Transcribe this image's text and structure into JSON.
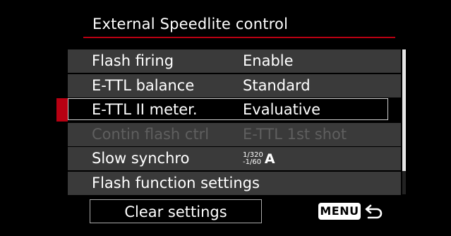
{
  "screen": {
    "title": "External Speedlite control"
  },
  "menu": {
    "items": [
      {
        "label": "Flash firing",
        "value": "Enable",
        "state": "normal"
      },
      {
        "label": "E-TTL balance",
        "value": "Standard",
        "state": "normal"
      },
      {
        "label": "E-TTL II meter.",
        "value": "Evaluative",
        "state": "selected"
      },
      {
        "label": "Contin flash ctrl",
        "value": "E-TTL 1st shot",
        "state": "disabled"
      },
      {
        "label": "Slow synchro",
        "value_top": "1/320",
        "value_bottom": "-1/60",
        "value_mode": "A",
        "state": "normal"
      },
      {
        "label": "Flash function settings",
        "value": "",
        "state": "normal"
      }
    ]
  },
  "footer": {
    "clear_label": "Clear settings",
    "menu_label": "MENU",
    "return_icon": "return-arrow-icon"
  },
  "colors": {
    "accent": "#b80012",
    "row_bg": "#3a3a3a",
    "disabled_text": "#5f5f5f"
  }
}
